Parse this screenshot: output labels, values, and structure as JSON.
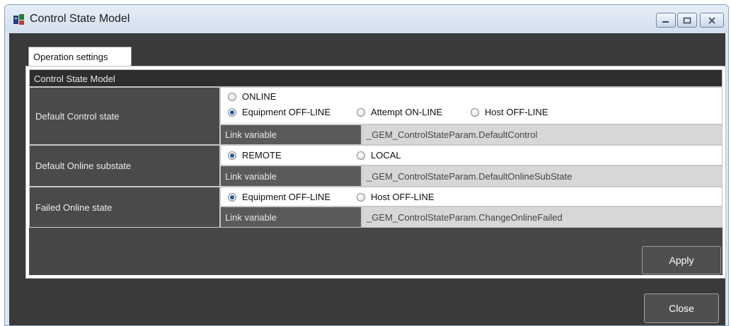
{
  "window": {
    "title": "Control State Model",
    "icon": "app-icon",
    "controls": [
      "minimize-icon",
      "maximize-icon",
      "close-icon"
    ]
  },
  "tabs": [
    {
      "label": "Operation settings",
      "active": true
    }
  ],
  "section": {
    "title": "Control State Model"
  },
  "rows": {
    "default_control": {
      "label": "Default Control state",
      "options": [
        {
          "label": "ONLINE",
          "selected": false
        },
        {
          "label": "Equipment OFF-LINE",
          "selected": true
        },
        {
          "label": "Attempt ON-LINE",
          "selected": false
        },
        {
          "label": "Host OFF-LINE",
          "selected": false
        }
      ],
      "link_label": "Link variable",
      "link_value": "_GEM_ControlStateParam.DefaultControl"
    },
    "default_online": {
      "label": "Default Online substate",
      "options": [
        {
          "label": "REMOTE",
          "selected": true
        },
        {
          "label": "LOCAL",
          "selected": false
        }
      ],
      "link_label": "Link variable",
      "link_value": "_GEM_ControlStateParam.DefaultOnlineSubState"
    },
    "failed_online": {
      "label": "Failed Online state",
      "options": [
        {
          "label": "Equipment OFF-LINE",
          "selected": true
        },
        {
          "label": "Host OFF-LINE",
          "selected": false
        }
      ],
      "link_label": "Link variable",
      "link_value": "_GEM_ControlStateParam.ChangeOnlineFailed"
    }
  },
  "buttons": {
    "apply": "Apply",
    "close": "Close"
  },
  "colors": {
    "panel_dark": "#474747",
    "client_bg": "#3a3a3a",
    "radio_selected": "#2a5aa8",
    "title_bar": "#dbe6f3"
  }
}
